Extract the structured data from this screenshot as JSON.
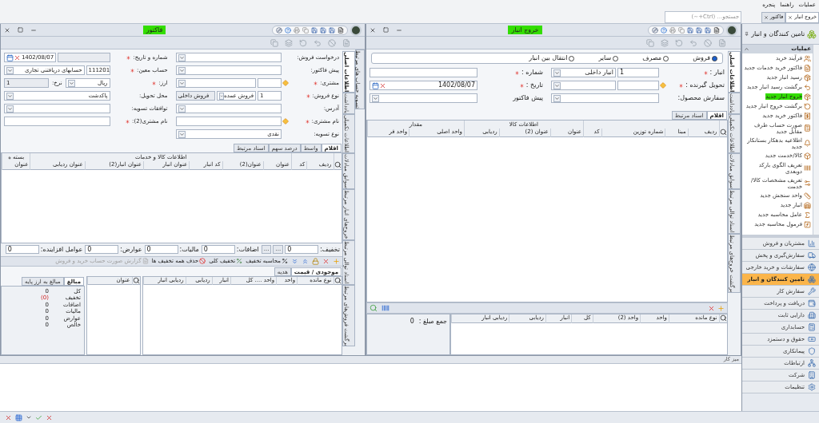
{
  "menu_bar": {
    "items": [
      "عملیات",
      "راهنما",
      "پنجره"
    ]
  },
  "search": {
    "placeholder": "جستجو... (Ctrl+~)"
  },
  "document_tabs": [
    {
      "label": "خروج انبار",
      "selected": true
    },
    {
      "label": "فاکتور",
      "selected": false
    }
  ],
  "sidebar": {
    "title": "تامین کنندگان و انبار",
    "section": "عملیات",
    "actions": [
      {
        "label": "فرآیند خرید",
        "selected": false
      },
      {
        "label": "فاکتور خرید خدمات جدید",
        "selected": false
      },
      {
        "label": "رسید انبار جدید",
        "selected": false
      },
      {
        "label": "برگشت رسید انبار جدید",
        "selected": false
      },
      {
        "label": "خروج انبار جدید",
        "selected": true
      },
      {
        "label": "برگشت خروج انبار جدید",
        "selected": false
      },
      {
        "label": "فاکتور خرید جدید",
        "selected": false
      },
      {
        "label": "صورت حساب طرف مقابل جدید",
        "selected": false
      },
      {
        "label": "اطلاعیه بدهکار بستانکار جدید",
        "selected": false
      },
      {
        "label": "کالا/خدمت جدید",
        "selected": false
      },
      {
        "label": "تعریف الگوی بارکد دوبعدی",
        "selected": false
      },
      {
        "label": "تعریف مشخصات کالا/خدمت",
        "selected": false
      },
      {
        "label": "واحد سنجش جدید",
        "selected": false
      },
      {
        "label": "انبار جدید",
        "selected": false
      },
      {
        "label": "عامل محاسبه جدید",
        "selected": false
      },
      {
        "label": "فرمول محاسبه جدید",
        "selected": false
      }
    ],
    "modules": [
      {
        "label": "مشتریان و فروش",
        "selected": false
      },
      {
        "label": "سفارش‌گیری و پخش",
        "selected": false
      },
      {
        "label": "سفارشات و خرید خارجی",
        "selected": false
      },
      {
        "label": "تامین کنندگان و انبار",
        "selected": true
      },
      {
        "label": "سفارش کار",
        "selected": false
      },
      {
        "label": "دریافت و پرداخت",
        "selected": false
      },
      {
        "label": "دارایی ثابت",
        "selected": false
      },
      {
        "label": "حسابداری",
        "selected": false
      },
      {
        "label": "حقوق و دستمزد",
        "selected": false
      },
      {
        "label": "پیمانکاری",
        "selected": false
      },
      {
        "label": "ارتباطات",
        "selected": false
      },
      {
        "label": "شرکت",
        "selected": false
      },
      {
        "label": "تنظیمات",
        "selected": false
      }
    ]
  },
  "exit_window": {
    "title": "خروج انبار",
    "side_tabs": [
      {
        "label": "اطلاعات اصلی",
        "selected": true
      },
      {
        "label": "یادداشت",
        "selected": false
      },
      {
        "label": "اطلاعات تکمیلی",
        "selected": false
      },
      {
        "label": "سوابق مبادلات",
        "selected": false
      },
      {
        "label": "اسناد توالی مرتبط",
        "selected": false
      },
      {
        "label": "برگشت خروج‌های مرتبط",
        "selected": false
      }
    ],
    "radios": [
      {
        "label": "فروش",
        "selected": true
      },
      {
        "label": "مصرف",
        "selected": false
      },
      {
        "label": "سایر",
        "selected": false
      },
      {
        "label": "انتقال بین انبار",
        "selected": false
      }
    ],
    "field_columns": [
      [
        {
          "label": "انبار :",
          "required": true,
          "picker": false,
          "inputs": [
            {
              "kind": "number",
              "value": "1"
            },
            {
              "kind": "combo",
              "value": "انبار داخلی"
            }
          ]
        },
        {
          "label": "تحویل گیرنده :",
          "required": true,
          "picker": true,
          "inputs": [
            {
              "kind": "number"
            },
            {
              "kind": "combo"
            }
          ]
        },
        {
          "label": "سفارش محصول:",
          "required": false,
          "picker": false,
          "inputs": [
            {
              "kind": "combo"
            }
          ]
        }
      ],
      [
        {
          "label": "شماره :",
          "required": true,
          "picker": false,
          "inputs": [
            {
              "kind": "text"
            }
          ]
        },
        {
          "label": "تاریخ :",
          "required": true,
          "picker": false,
          "inputs": [
            {
              "kind": "date",
              "value": "1402/08/07"
            }
          ]
        },
        {
          "label": "پیش فاکتور",
          "required": false,
          "picker": false,
          "inputs": [
            {
              "kind": "combo"
            }
          ]
        }
      ]
    ],
    "tabs": [
      {
        "label": "اقلام",
        "selected": true
      },
      {
        "label": "اسناد مرتبط",
        "selected": false
      }
    ],
    "grid": {
      "groups": [
        "اطلاعات کالا",
        "مقدار"
      ],
      "columns": [
        "ردیف",
        "مبنا",
        "شماره توزین",
        "کد",
        "عنوان",
        "عنوان (2)",
        "ردیابی",
        "واحد اصلی",
        "واحد فر"
      ]
    },
    "stock_grid": {
      "columns": [
        "نوع مانده",
        "واحد",
        "واحد (2)",
        "کل",
        "انبار",
        "ردیابی",
        "ردیابی انبار"
      ]
    },
    "total": {
      "label": "جمع مبلغ :",
      "value": "0"
    }
  },
  "invoice_window": {
    "title": "فاکتور",
    "outer_tab": {
      "label": "تسویه حساب های مرتبط"
    },
    "side_tabs": [
      {
        "label": "اطلاعات اصلی",
        "selected": true
      },
      {
        "label": "یادداشت",
        "selected": false
      },
      {
        "label": "اطلاعات تکمیلی",
        "selected": false
      },
      {
        "label": "سوابق مبادلات",
        "selected": false
      },
      {
        "label": "خروج‌های انبار مرتبط",
        "selected": false
      },
      {
        "label": "اسناد توالی مرتبط",
        "selected": false
      },
      {
        "label": "برگشت فروش‌های مرتبط",
        "selected": false
      }
    ],
    "field_columns": [
      [
        {
          "label": "درخواست فروش:",
          "required": false,
          "picker": false,
          "inputs": [
            {
              "kind": "combo"
            }
          ]
        },
        {
          "label": "پیش فاکتور:",
          "required": false,
          "picker": false,
          "inputs": [
            {
              "kind": "combo"
            }
          ]
        },
        {
          "label": "مشتری:",
          "required": true,
          "picker": true,
          "inputs": [
            {
              "kind": "number"
            },
            {
              "kind": "combo"
            }
          ]
        },
        {
          "label": "نوع فروش:",
          "required": true,
          "picker": false,
          "inputs": [
            {
              "kind": "number",
              "value": "1"
            },
            {
              "kind": "combo",
              "value": "فروش عمده"
            },
            {
              "kind": "readonly",
              "value": "فروش داخلی"
            }
          ]
        },
        {
          "label": "آدرس:",
          "required": false,
          "picker": false,
          "inputs": [
            {
              "kind": "combo"
            }
          ]
        },
        {
          "label": "نام مشتری:",
          "required": true,
          "picker": true,
          "inputs": [
            {
              "kind": "text"
            }
          ]
        },
        {
          "label": "نوع تسویه:",
          "required": false,
          "picker": false,
          "inputs": [
            {
              "kind": "combo",
              "value": "نقدی"
            }
          ]
        }
      ],
      [
        {
          "label": "شماره و تاریخ:",
          "required": true,
          "picker": false,
          "inputs": [
            {
              "kind": "readonly"
            },
            {
              "kind": "date",
              "value": "1402/08/07"
            }
          ]
        },
        {
          "label": "حساب معین:",
          "required": true,
          "picker": false,
          "inputs": [
            {
              "kind": "number",
              "value": "111201"
            },
            {
              "kind": "combo",
              "value": "حسابهای دریافتنی تجاری"
            }
          ]
        },
        {
          "label": "ارز:",
          "required": true,
          "picker": false,
          "inputs": [
            {
              "kind": "combo",
              "value": "ریال"
            },
            {
              "kind": "label",
              "value": "نرخ:"
            },
            {
              "kind": "readonly",
              "value": "1"
            }
          ]
        },
        {
          "label": "محل تحویل:",
          "required": false,
          "picker": false,
          "inputs": [
            {
              "kind": "combo",
              "value": "پاکدشت"
            }
          ]
        },
        {
          "label": "توافقات تسویه:",
          "required": false,
          "picker": false,
          "inputs": [
            {
              "kind": "combo"
            }
          ]
        },
        {
          "label": "نام مشتری(2):",
          "required": true,
          "picker": false,
          "inputs": [
            {
              "kind": "text"
            }
          ]
        }
      ]
    ],
    "tabs": [
      {
        "label": "اقلام",
        "selected": true
      },
      {
        "label": "واسط",
        "selected": false
      },
      {
        "label": "درصد سهم",
        "selected": false
      },
      {
        "label": "اسناد مرتبط",
        "selected": false
      }
    ],
    "grid": {
      "groups": [
        "اطلاعات کالا و خدمات",
        "بسته ه"
      ],
      "columns": [
        "ردیف",
        "کد",
        "عنوان",
        "عنوان(2)",
        "کد انبار",
        "عنوان انبار",
        "عنوان انبار(2)",
        "عنوان ردیابی",
        "عنوان"
      ]
    },
    "totals": [
      {
        "label": "تخفیف:",
        "value": "0",
        "buttons": [
          "...",
          "..."
        ]
      },
      {
        "label": "اضافات:",
        "value": "0"
      },
      {
        "label": "مالیات:",
        "value": "0"
      },
      {
        "label": "عوارض:",
        "value": "0"
      },
      {
        "label": "عوامل افزاینده:",
        "value": "0"
      }
    ],
    "actions": [
      {
        "label": "محاسبه تخفیف",
        "disabled": false
      },
      {
        "label": "تخفیف کلی",
        "disabled": false
      },
      {
        "label": "حذف همه تخفیف ها",
        "disabled": false
      },
      {
        "label": "گزارش صورت حساب خرید و فروش",
        "disabled": true
      }
    ],
    "lower_tabs": [
      {
        "label": "موجودی / قیمت",
        "selected": true
      },
      {
        "label": "هدیه",
        "selected": false
      }
    ],
    "stock_grid": {
      "columns": [
        "نوع مانده",
        "واحد",
        "واحد .... کل",
        "انبار",
        "ردیابی",
        "ردیابی انبار"
      ]
    },
    "title_grid": {
      "columns": [
        "عنوان"
      ]
    },
    "amount_tabs": [
      {
        "label": "مبالغ",
        "selected": true
      },
      {
        "label": "مبالغ به ارز پایه",
        "selected": false
      }
    ],
    "amounts": [
      {
        "label": "کل",
        "value": "0",
        "negative": false
      },
      {
        "label": "تخفیف",
        "value": "(0)",
        "negative": true
      },
      {
        "label": "اضافات",
        "value": "0",
        "negative": false
      },
      {
        "label": "مالیات",
        "value": "0",
        "negative": false
      },
      {
        "label": "عوارض",
        "value": "0",
        "negative": false
      },
      {
        "label": "خالص",
        "value": "0",
        "negative": false
      }
    ]
  },
  "desk": {
    "title": "میز کار"
  }
}
